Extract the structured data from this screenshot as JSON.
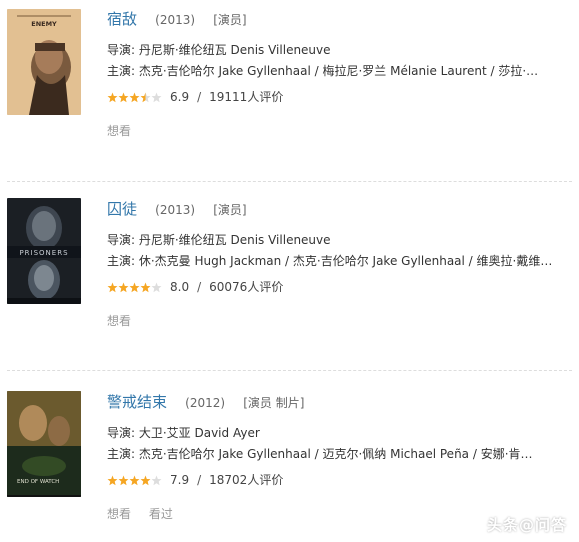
{
  "movies": [
    {
      "title": "宿敌",
      "year": "(2013)",
      "roles": "[演员]",
      "director": "导演: 丹尼斯·维伦纽瓦 Denis Villeneuve",
      "cast": "主演: 杰克·吉伦哈尔 Jake Gyllenhaal / 梅拉尼·罗兰 Mélanie Laurent / 莎拉·…",
      "rating": "6.9",
      "rating_value": 3.5,
      "votes": "19111人评价",
      "actions": [
        "想看"
      ],
      "poster_text": "ENEMY"
    },
    {
      "title": "囚徒",
      "year": "(2013)",
      "roles": "[演员]",
      "director": "导演: 丹尼斯·维伦纽瓦 Denis Villeneuve",
      "cast": "主演: 休·杰克曼 Hugh Jackman / 杰克·吉伦哈尔 Jake Gyllenhaal / 维奥拉·戴维…",
      "rating": "8.0",
      "rating_value": 4,
      "votes": "60076人评价",
      "actions": [
        "想看"
      ],
      "poster_text": "PRISONERS"
    },
    {
      "title": "警戒结束",
      "year": "(2012)",
      "roles": "[演员 制片]",
      "director": "导演: 大卫·艾亚 David Ayer",
      "cast": "主演: 杰克·吉伦哈尔 Jake Gyllenhaal / 迈克尔·佩纳 Michael Peña / 安娜·肯…",
      "rating": "7.9",
      "rating_value": 4,
      "votes": "18702人评价",
      "actions": [
        "想看",
        "看过"
      ],
      "poster_text": "END OF WATCH"
    }
  ],
  "watermark": "头条@问答",
  "colors": {
    "title": "#3377aa",
    "star": "#f5a623",
    "star_empty": "#dddddd"
  }
}
